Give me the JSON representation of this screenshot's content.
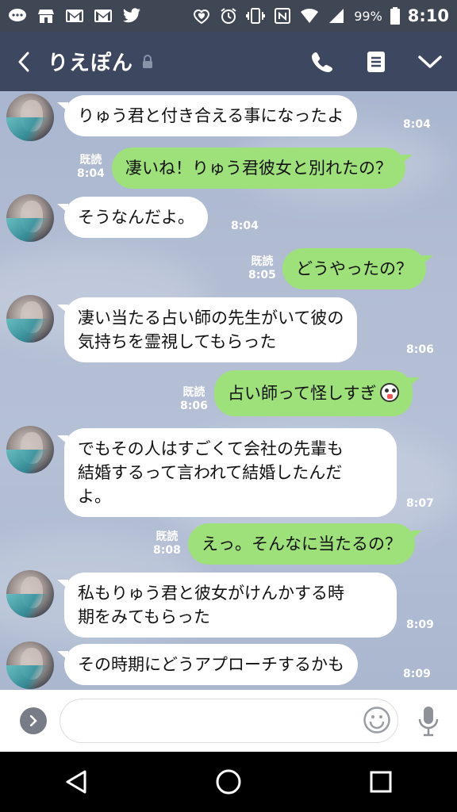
{
  "status_bar": {
    "battery_percent": "99%",
    "time": "8:10",
    "icons": [
      "chat-bubble-icon",
      "store-icon",
      "gmail-icon",
      "gmail-icon",
      "twitter-icon",
      "alarm-heart-icon",
      "alarm-clock-icon",
      "vibrate-icon",
      "nfc-icon",
      "wifi-icon",
      "signal-icon",
      "battery-icon"
    ]
  },
  "header": {
    "title": "りえぽん",
    "background": "#3d4760"
  },
  "messages": [
    {
      "side": "left",
      "text": "りゅう君と付き合える事になったよ",
      "time": "8:04"
    },
    {
      "side": "right",
      "text": "凄いね！りゅう君彼女と別れたの？",
      "time": "8:04",
      "read": "既読"
    },
    {
      "side": "left",
      "text": "そうなんだよ。",
      "time": "8:04"
    },
    {
      "side": "right",
      "text": "どうやったの？",
      "time": "8:05",
      "read": "既読"
    },
    {
      "side": "left",
      "line1": "凄い当たる占い師の先生がいて彼の",
      "line2": "気持ちを霊視してもらった",
      "time": "8:06"
    },
    {
      "side": "right",
      "text": "占い師って怪しすぎ",
      "emoji": "shocked-face-icon",
      "time": "8:06",
      "read": "既読"
    },
    {
      "side": "left",
      "line1": "でもその人はすごくて会社の先輩も",
      "line2": "結婚するって言われて結婚したんだ",
      "line3": "よ。",
      "time": "8:07"
    },
    {
      "side": "right",
      "text": "えっ。そんなに当たるの？",
      "time": "8:08",
      "read": "既読"
    },
    {
      "side": "left",
      "line1": "私もりゅう君と彼女がけんかする時",
      "line2": "期をみてもらった",
      "time": "8:09"
    },
    {
      "side": "left",
      "text": "その時期にどうアプローチするかも",
      "time": "8:09"
    }
  ],
  "colors": {
    "outgoing_bubble": "#9ee07a",
    "incoming_bubble": "#ffffff",
    "chat_background": "#b2bdd3"
  },
  "input": {
    "placeholder": "",
    "value": ""
  }
}
